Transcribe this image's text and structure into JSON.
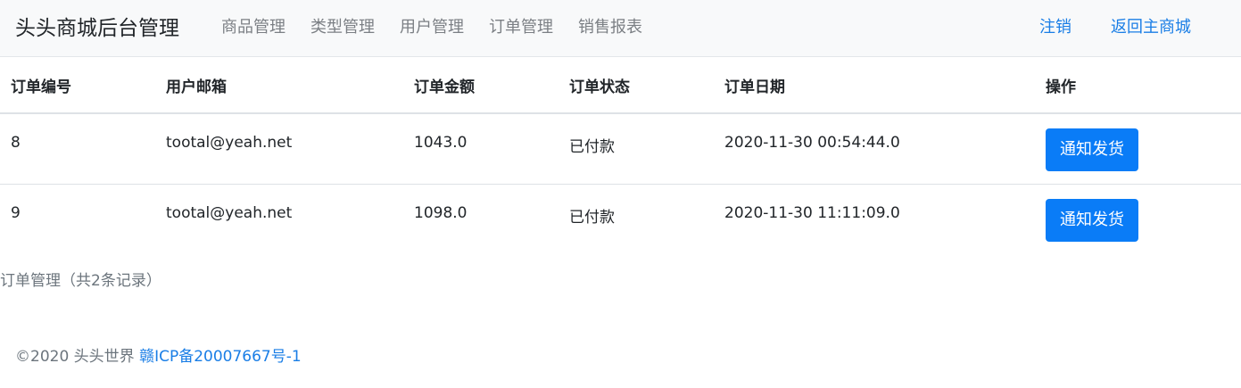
{
  "navbar": {
    "brand": "头头商城后台管理",
    "links": [
      "商品管理",
      "类型管理",
      "用户管理",
      "订单管理",
      "销售报表"
    ],
    "logout": "注销",
    "back_to_store": "返回主商城"
  },
  "table": {
    "headers": [
      "订单编号",
      "用户邮箱",
      "订单金额",
      "订单状态",
      "订单日期",
      "操作"
    ],
    "rows": [
      {
        "id": "8",
        "email": "tootal@yeah.net",
        "amount": "1043.0",
        "status": "已付款",
        "date": "2020-11-30 00:54:44.0",
        "action": "通知发货"
      },
      {
        "id": "9",
        "email": "tootal@yeah.net",
        "amount": "1098.0",
        "status": "已付款",
        "date": "2020-11-30 11:11:09.0",
        "action": "通知发货"
      }
    ]
  },
  "summary": "订单管理（共2条记录）",
  "footer": {
    "copyright": "©2020 头头世界",
    "icp": "赣ICP备20007667号-1"
  },
  "colors": {
    "primary": "#0a7cf7",
    "link": "#1a7ee6",
    "navbar_bg": "#f8f9fa",
    "muted": "#6c757d"
  }
}
